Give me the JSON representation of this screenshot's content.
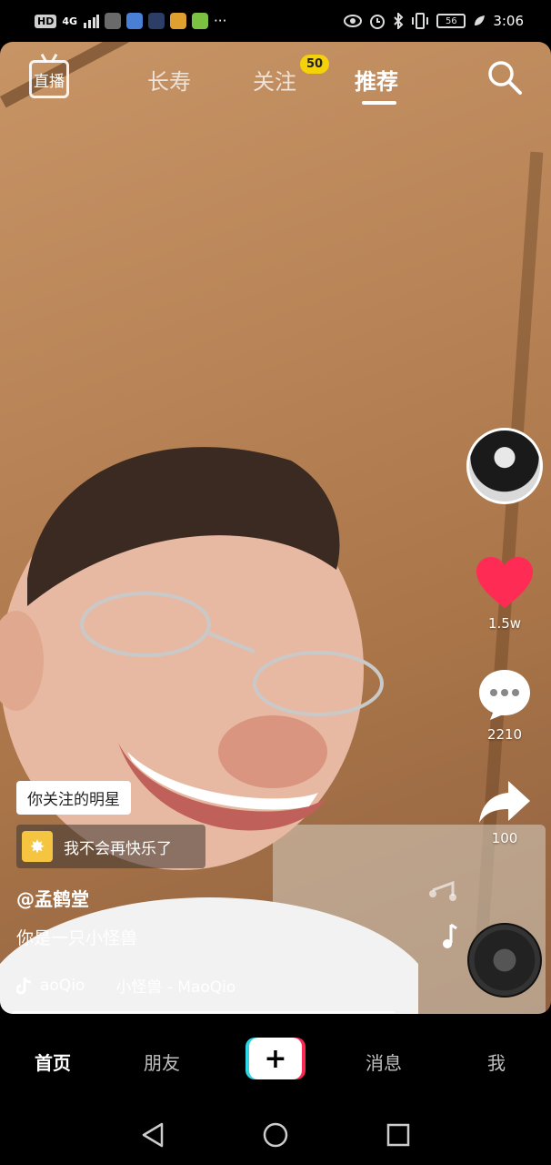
{
  "status_bar": {
    "left_badge": "HD",
    "network": "4G",
    "battery": "56",
    "time": "3:06"
  },
  "top_nav": {
    "live_label": "直播",
    "tabs": [
      {
        "label": "长寿",
        "active": false
      },
      {
        "label": "关注",
        "active": false,
        "badge": "50"
      },
      {
        "label": "推荐",
        "active": true
      }
    ]
  },
  "actions": {
    "likes": "1.5w",
    "comments": "2210",
    "shares": "100",
    "like_color": "#fe2c55"
  },
  "caption": {
    "follow_chip": "你关注的明星",
    "sticker_text": "我不会再快乐了",
    "author": "@孟鹤堂",
    "description": "你是一只小怪兽",
    "music_user": "aoQio",
    "music_title": "小怪兽 - MaoQio"
  },
  "tab_bar": {
    "items": [
      "首页",
      "朋友",
      "消息",
      "我"
    ],
    "plus": "+"
  }
}
